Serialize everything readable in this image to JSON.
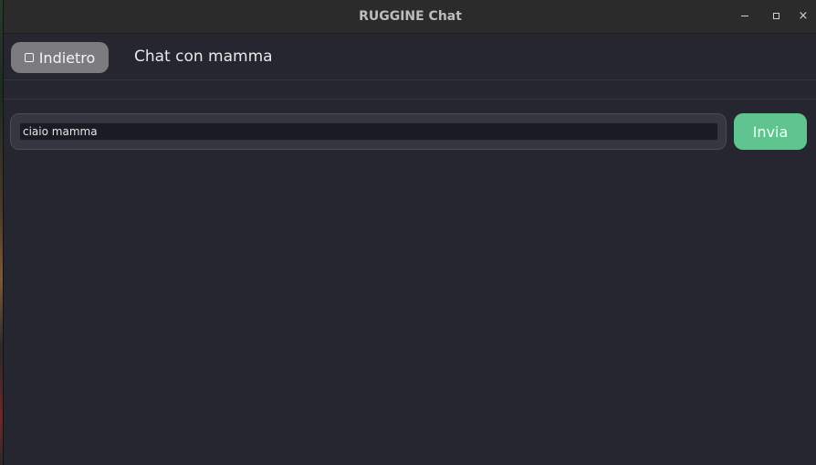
{
  "window": {
    "title": "RUGGINE Chat",
    "controls": {
      "minimize": "minimize-icon",
      "maximize": "maximize-icon",
      "close": "×"
    }
  },
  "header": {
    "back_label": "Indietro",
    "back_icon": "square-icon",
    "chat_title": "Chat con mamma"
  },
  "composer": {
    "input_value": "ciaio mamma",
    "send_label": "Invia"
  },
  "colors": {
    "background": "#262631",
    "accent": "#5fc48f",
    "back_button": "#7c7c7e"
  }
}
